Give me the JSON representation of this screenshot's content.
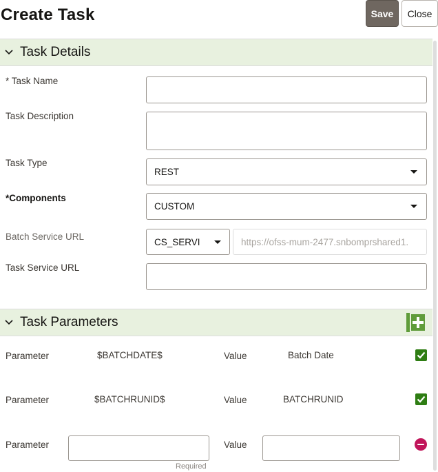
{
  "header": {
    "title": "Create Task",
    "save_label": "Save",
    "close_label": "Close"
  },
  "task_details": {
    "section_title": "Task Details",
    "task_name": {
      "label": "* Task Name",
      "value": ""
    },
    "task_description": {
      "label": "Task Description",
      "value": ""
    },
    "task_type": {
      "label": "Task Type",
      "selected": "REST"
    },
    "components": {
      "label": "*Components",
      "selected": "CUSTOM"
    },
    "batch_service_url": {
      "label": "Batch Service URL",
      "service_selected": "CS_SERVI",
      "url_value": "https://ofss-mum-2477.snbomprshared1."
    },
    "task_service_url": {
      "label": "Task Service URL",
      "value": ""
    }
  },
  "task_parameters": {
    "section_title": "Task Parameters",
    "rows": [
      {
        "param_label": "Parameter",
        "param_name": "$BATCHDATE$",
        "value_label": "Value",
        "value": "Batch Date",
        "checked": true
      },
      {
        "param_label": "Parameter",
        "param_name": "$BATCHRUNID$",
        "value_label": "Value",
        "value": "BATCHRUNID",
        "checked": true
      }
    ],
    "new_row": {
      "param_label": "Parameter",
      "param_value": "",
      "value_label": "Value",
      "value_value": "",
      "required_hint": "Required"
    }
  },
  "colors": {
    "section_bg": "#e8f1df",
    "save_bg": "#6f6760",
    "check_green": "#2e7d13",
    "add_green": "#5f9c3a",
    "remove_red": "#c1155a"
  },
  "icons": {
    "collapse": "chevron-down-icon",
    "add": "add-parameter-icon",
    "check": "checkbox-checked-icon",
    "remove": "remove-circle-icon"
  }
}
